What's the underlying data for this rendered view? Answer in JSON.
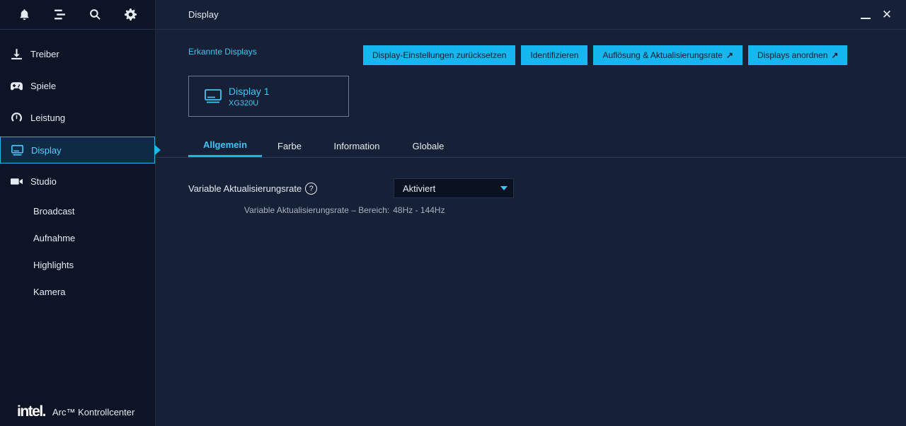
{
  "header": {
    "title": "Display"
  },
  "sidebar": {
    "toolbar": [
      "bell-icon",
      "list-icon",
      "search-icon",
      "gear-icon"
    ],
    "items": [
      {
        "label": "Treiber",
        "icon": "download-icon"
      },
      {
        "label": "Spiele",
        "icon": "gamepad-icon"
      },
      {
        "label": "Leistung",
        "icon": "gauge-icon"
      },
      {
        "label": "Display",
        "icon": "monitor-icon",
        "active": true
      },
      {
        "label": "Studio",
        "icon": "camera-icon"
      }
    ],
    "subitems": [
      "Broadcast",
      "Aufnahme",
      "Highlights",
      "Kamera"
    ],
    "brand": {
      "logo": "intel.",
      "product": "Arc™ Kontrollcenter"
    }
  },
  "main": {
    "detected_label": "Erkannte Displays",
    "actions": [
      {
        "label": "Display-Einstellungen zurücksetzen",
        "external": false
      },
      {
        "label": "Identifizieren",
        "external": false
      },
      {
        "label": "Auflösung & Aktualisierungsrate",
        "external": true
      },
      {
        "label": "Displays anordnen",
        "external": true
      }
    ],
    "display_card": {
      "name": "Display 1",
      "model": "XG320U"
    },
    "tabs": [
      "Allgemein",
      "Farbe",
      "Information",
      "Globale"
    ],
    "active_tab": "Allgemein",
    "setting": {
      "label": "Variable Aktualisierungsrate",
      "value": "Aktiviert",
      "range_label": "Variable Aktualisierungsrate – Bereich:",
      "range_value": "48Hz - 144Hz"
    }
  },
  "colors": {
    "accent": "#16b6ee",
    "accent_text": "#3fc6f5",
    "bg": "#162037",
    "sidebar_bg": "#0d1426"
  }
}
